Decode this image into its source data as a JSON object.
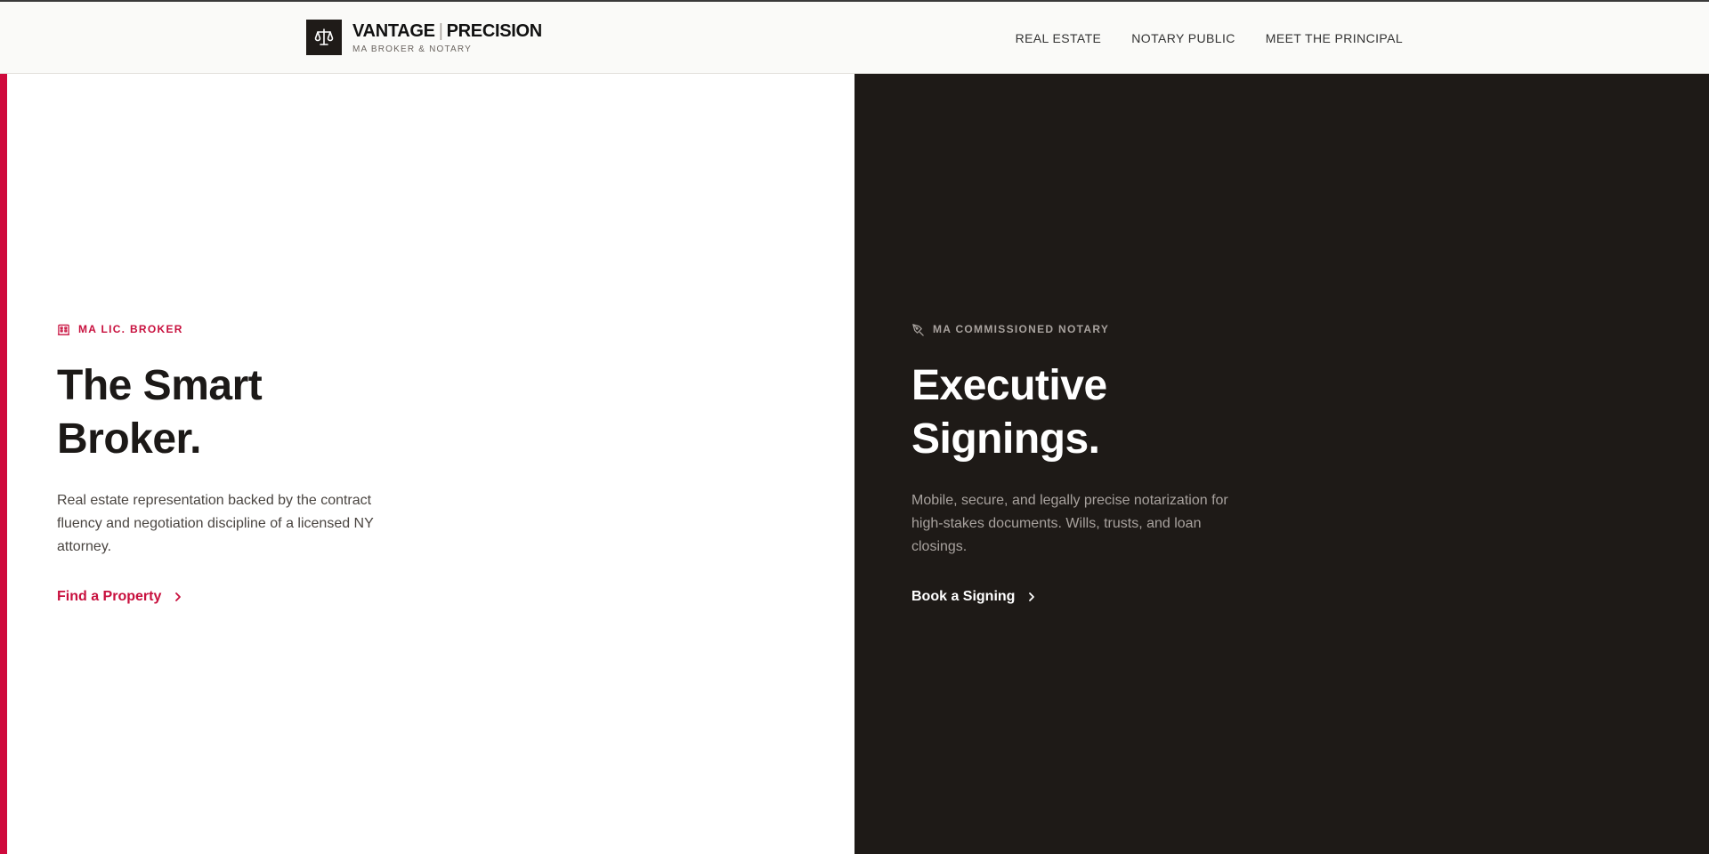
{
  "header": {
    "brand_name_left": "VANTAGE",
    "brand_separator": "|",
    "brand_name_right": "PRECISION",
    "brand_subtitle": "MA BROKER & NOTARY",
    "logo_icon": "scales-icon",
    "nav": [
      {
        "label": "REAL ESTATE"
      },
      {
        "label": "NOTARY PUBLIC"
      },
      {
        "label": "MEET THE PRINCIPAL"
      }
    ]
  },
  "broker": {
    "eyebrow": "MA LIC. BROKER",
    "eyebrow_icon": "building-icon",
    "title_line1": "The Smart",
    "title_line2": "Broker.",
    "description": "Real estate representation backed by the contract fluency and negotiation discipline of a licensed NY attorney.",
    "cta_label": "Find a Property",
    "cta_icon": "chevron-right-icon"
  },
  "notary": {
    "eyebrow": "MA COMMISSIONED NOTARY",
    "eyebrow_icon": "pen-nib-icon",
    "title_line1": "Executive",
    "title_line2": "Signings.",
    "description": "Mobile, secure, and legally precise notarization for high-stakes documents. Wills, trusts, and loan closings.",
    "cta_label": "Book a Signing",
    "cta_icon": "chevron-right-icon"
  },
  "colors": {
    "accent": "#cf0a3c",
    "dark_panel": "#1e1a17",
    "logo_bg": "#1f1b18"
  }
}
